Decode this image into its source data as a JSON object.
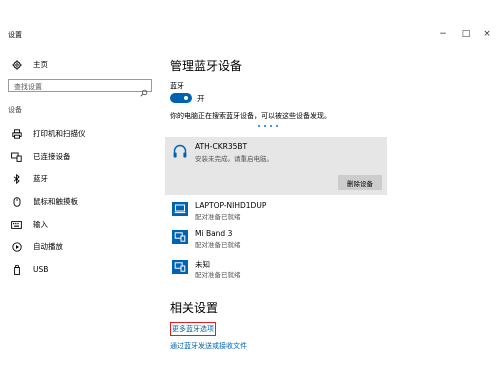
{
  "window": {
    "title": "设置",
    "minimize": "−",
    "maximize": "□",
    "close": "×"
  },
  "sidebar": {
    "home": "主页",
    "search_placeholder": "查找设置",
    "section": "设备",
    "items": [
      {
        "label": "打印机和扫描仪",
        "icon": "printer-icon"
      },
      {
        "label": "已连接设备",
        "icon": "connected-devices-icon"
      },
      {
        "label": "蓝牙",
        "icon": "bluetooth-icon"
      },
      {
        "label": "鼠标和触摸板",
        "icon": "mouse-icon"
      },
      {
        "label": "输入",
        "icon": "keyboard-icon"
      },
      {
        "label": "自动播放",
        "icon": "autoplay-icon"
      },
      {
        "label": "USB",
        "icon": "usb-icon"
      }
    ]
  },
  "main": {
    "title": "管理蓝牙设备",
    "bluetooth_label": "蓝牙",
    "toggle_state": "开",
    "toggle_on": true,
    "search_desc": "你的电脑正在搜索蓝牙设备，可以被这些设备发现。",
    "selected_device": {
      "name": "ATH-CKR35BT",
      "status": "安装未完成。请重启电脑。",
      "icon": "headphones-icon",
      "remove_label": "删除设备"
    },
    "devices": [
      {
        "name": "LAPTOP-NIHD1DUP",
        "status": "配对准备已就绪",
        "icon": "laptop-icon"
      },
      {
        "name": "Mi Band 3",
        "status": "配对准备已就绪",
        "icon": "device-icon"
      },
      {
        "name": "未知",
        "status": "配对准备已就绪",
        "icon": "device-icon"
      }
    ]
  },
  "related": {
    "title": "相关设置",
    "more_bluetooth": "更多蓝牙选项",
    "send_receive": "通过蓝牙发送或接收文件"
  },
  "colors": {
    "accent": "#0063b1",
    "selected_bg": "#e6e6e6",
    "highlight_border": "#e02020"
  }
}
